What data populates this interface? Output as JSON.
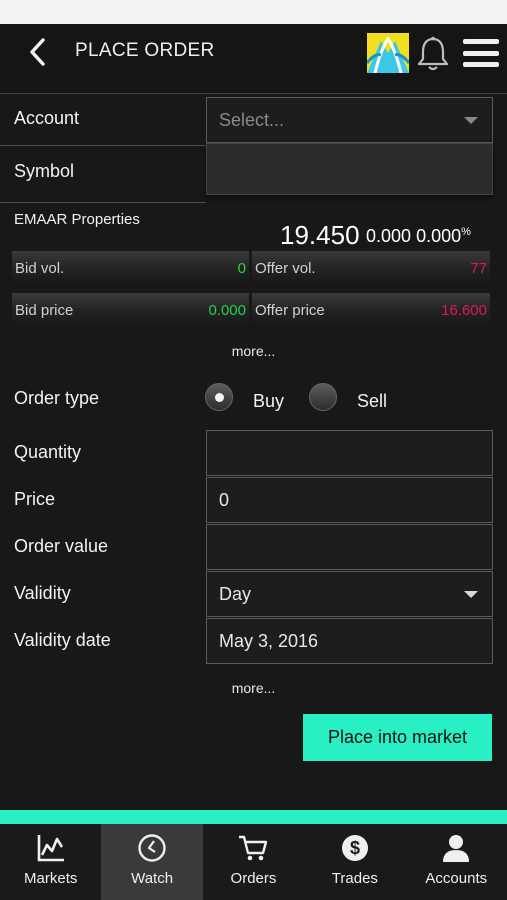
{
  "header": {
    "title": "PLACE ORDER",
    "back_icon": "chevron-left-icon",
    "notification_icon": "bell-icon",
    "menu_icon": "hamburger-menu-icon"
  },
  "form": {
    "account_label": "Account",
    "account_placeholder": "Select...",
    "symbol_label": "Symbol",
    "order_type_label": "Order type",
    "buy_label": "Buy",
    "sell_label": "Sell",
    "order_type_selected": "Buy",
    "quantity_label": "Quantity",
    "quantity_value": "",
    "price_label": "Price",
    "price_value": "0",
    "order_value_label": "Order value",
    "order_value_value": "",
    "validity_label": "Validity",
    "validity_value": "Day",
    "validity_date_label": "Validity date",
    "validity_date_value": "May 3, 2016",
    "more_label": "more...",
    "submit_label": "Place into market"
  },
  "quote": {
    "name": "EMAAR Properties",
    "last_price": "19.450",
    "change": "0.000",
    "change_pct": "0.000",
    "pct_sign": "%",
    "bid_vol_label": "Bid vol.",
    "bid_vol": "0",
    "offer_vol_label": "Offer vol.",
    "offer_vol": "77",
    "bid_price_label": "Bid price",
    "bid_price": "0.000",
    "offer_price_label": "Offer price",
    "offer_price": "16.600",
    "more_label": "more..."
  },
  "tabs": [
    {
      "label": "Markets",
      "icon": "line-chart-icon",
      "active": false
    },
    {
      "label": "Watch",
      "icon": "clock-icon",
      "active": true
    },
    {
      "label": "Orders",
      "icon": "cart-icon",
      "active": false
    },
    {
      "label": "Trades",
      "icon": "dollar-coin-icon",
      "active": false
    },
    {
      "label": "Accounts",
      "icon": "user-icon",
      "active": false
    }
  ],
  "colors": {
    "accent": "#29f0c4",
    "positive": "#1fd64a",
    "negative": "#e0185a",
    "background": "#181818"
  }
}
